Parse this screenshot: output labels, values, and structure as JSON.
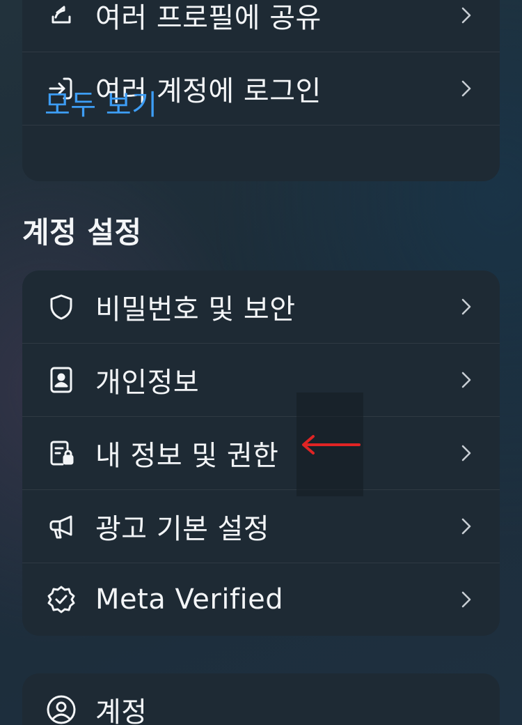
{
  "top_section": {
    "items": [
      {
        "label": "여러 프로필에 공유",
        "icon": "share-arrow-icon"
      },
      {
        "label": "여러 계정에 로그인",
        "icon": "login-arrow-icon"
      }
    ],
    "see_all": "모두 보기"
  },
  "account_settings": {
    "title": "계정 설정",
    "items": [
      {
        "label": "비밀번호 및 보안",
        "icon": "shield-icon"
      },
      {
        "label": "개인정보",
        "icon": "id-card-icon"
      },
      {
        "label": "내 정보 및 권한",
        "icon": "document-lock-icon"
      },
      {
        "label": "광고 기본 설정",
        "icon": "megaphone-icon"
      },
      {
        "label": "Meta Verified",
        "icon": "verified-badge-icon"
      }
    ]
  },
  "account_section": {
    "items": [
      {
        "label": "계정",
        "icon": "user-circle-icon"
      }
    ]
  },
  "annotation": {
    "arrow_color": "#e02424"
  },
  "colors": {
    "accent": "#3d9df5",
    "card": "#1e2a34",
    "text": "#f3f5f7"
  }
}
